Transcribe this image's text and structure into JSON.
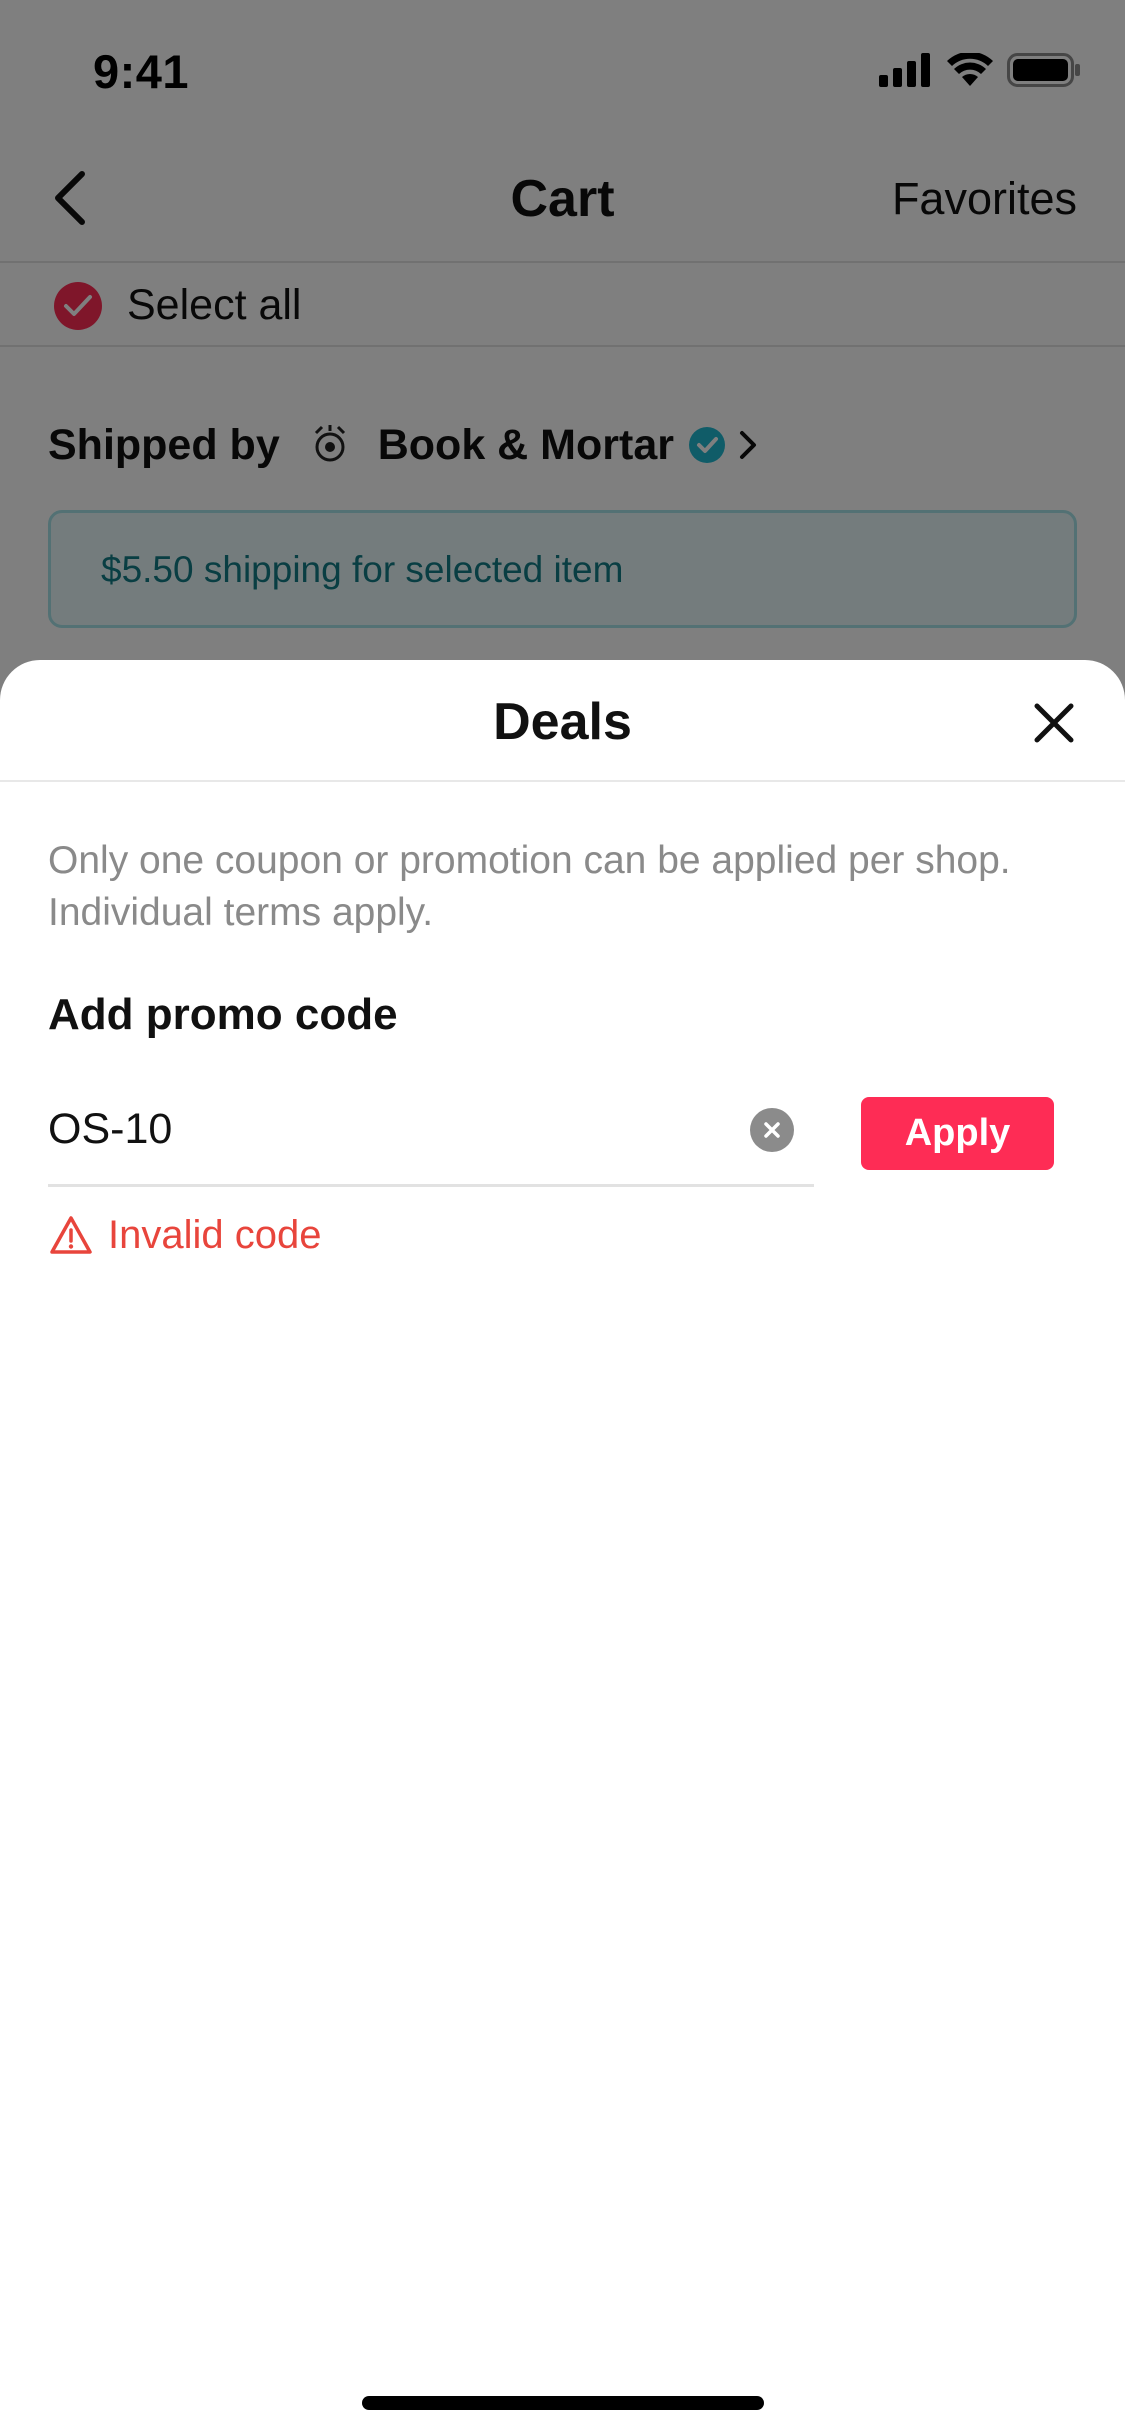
{
  "status_bar": {
    "time": "9:41"
  },
  "nav": {
    "back_icon": "chevron-left-icon",
    "title": "Cart",
    "favorites_label": "Favorites"
  },
  "select_all": {
    "label": "Select all",
    "checked": true
  },
  "shop": {
    "shipped_by_label": "Shipped by",
    "name": "Book & Mortar",
    "verified": true
  },
  "shipping_banner": {
    "text": "$5.50 shipping for selected item"
  },
  "sheet": {
    "title": "Deals",
    "notice": "Only one coupon or promotion can be applied per shop. Individual terms apply.",
    "promo_heading": "Add promo code",
    "promo_value": "OS-10",
    "apply_label": "Apply",
    "error_text": "Invalid code"
  },
  "colors": {
    "accent": "#fe2c55",
    "error": "#e8453c",
    "verified": "#20b8d0",
    "banner_text": "#137d86"
  }
}
